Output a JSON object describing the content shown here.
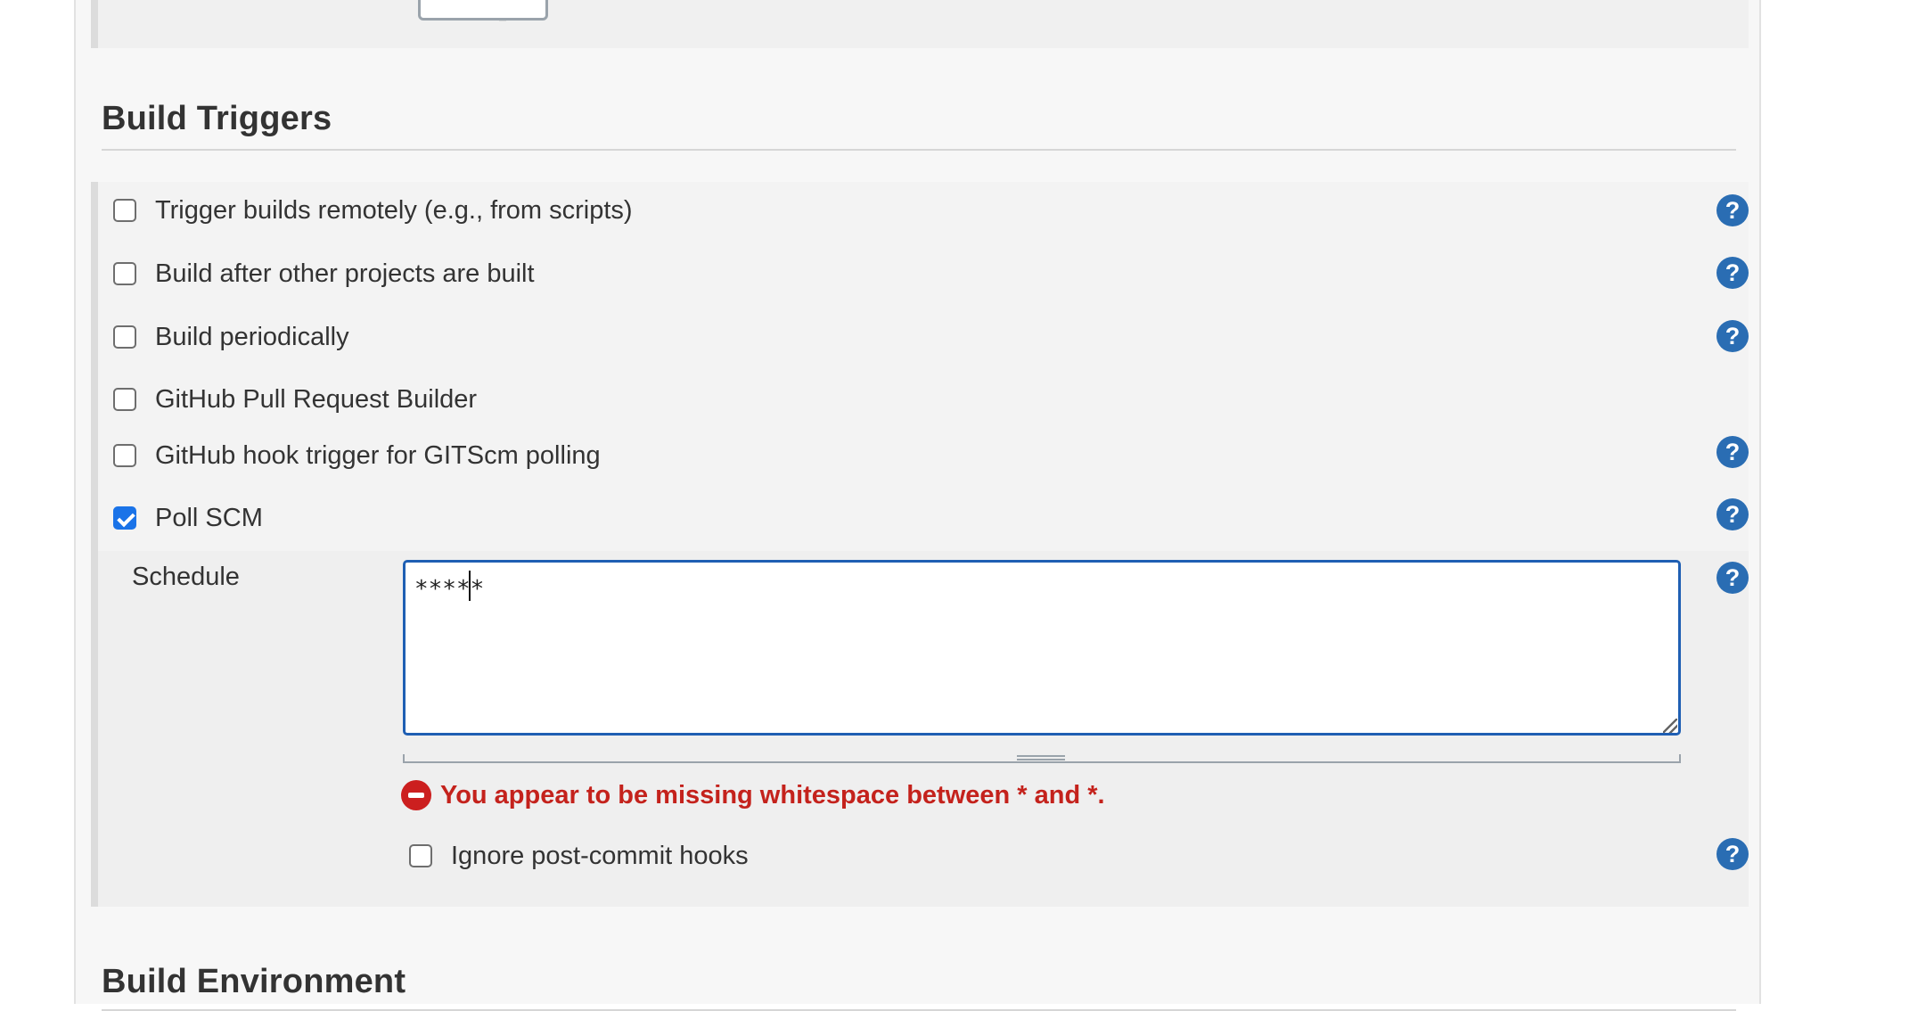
{
  "build_triggers": {
    "title": "Build Triggers",
    "options": [
      {
        "label": "Trigger builds remotely (e.g., from scripts)",
        "checked": false,
        "help": "?"
      },
      {
        "label": "Build after other projects are built",
        "checked": false,
        "help": "?"
      },
      {
        "label": "Build periodically",
        "checked": false,
        "help": "?"
      },
      {
        "label": "GitHub Pull Request Builder",
        "checked": false
      },
      {
        "label": "GitHub hook trigger for GITScm polling",
        "checked": false,
        "help": "?"
      },
      {
        "label": "Poll SCM",
        "checked": true,
        "help": "?"
      }
    ],
    "poll_scm": {
      "schedule_label": "Schedule",
      "schedule_value": "*****",
      "schedule_help": "?",
      "error_message": "You appear to be missing whitespace between * and *.",
      "ignore_hooks_label": "Ignore post-commit hooks",
      "ignore_hooks_checked": false,
      "ignore_hooks_help": "?"
    }
  },
  "build_environment": {
    "title": "Build Environment"
  },
  "icons": {
    "help": "help-icon",
    "error": "error-icon",
    "checkbox_checked_color": "#1a73e8",
    "error_color": "#c4221c",
    "help_color": "#2a6db3"
  }
}
